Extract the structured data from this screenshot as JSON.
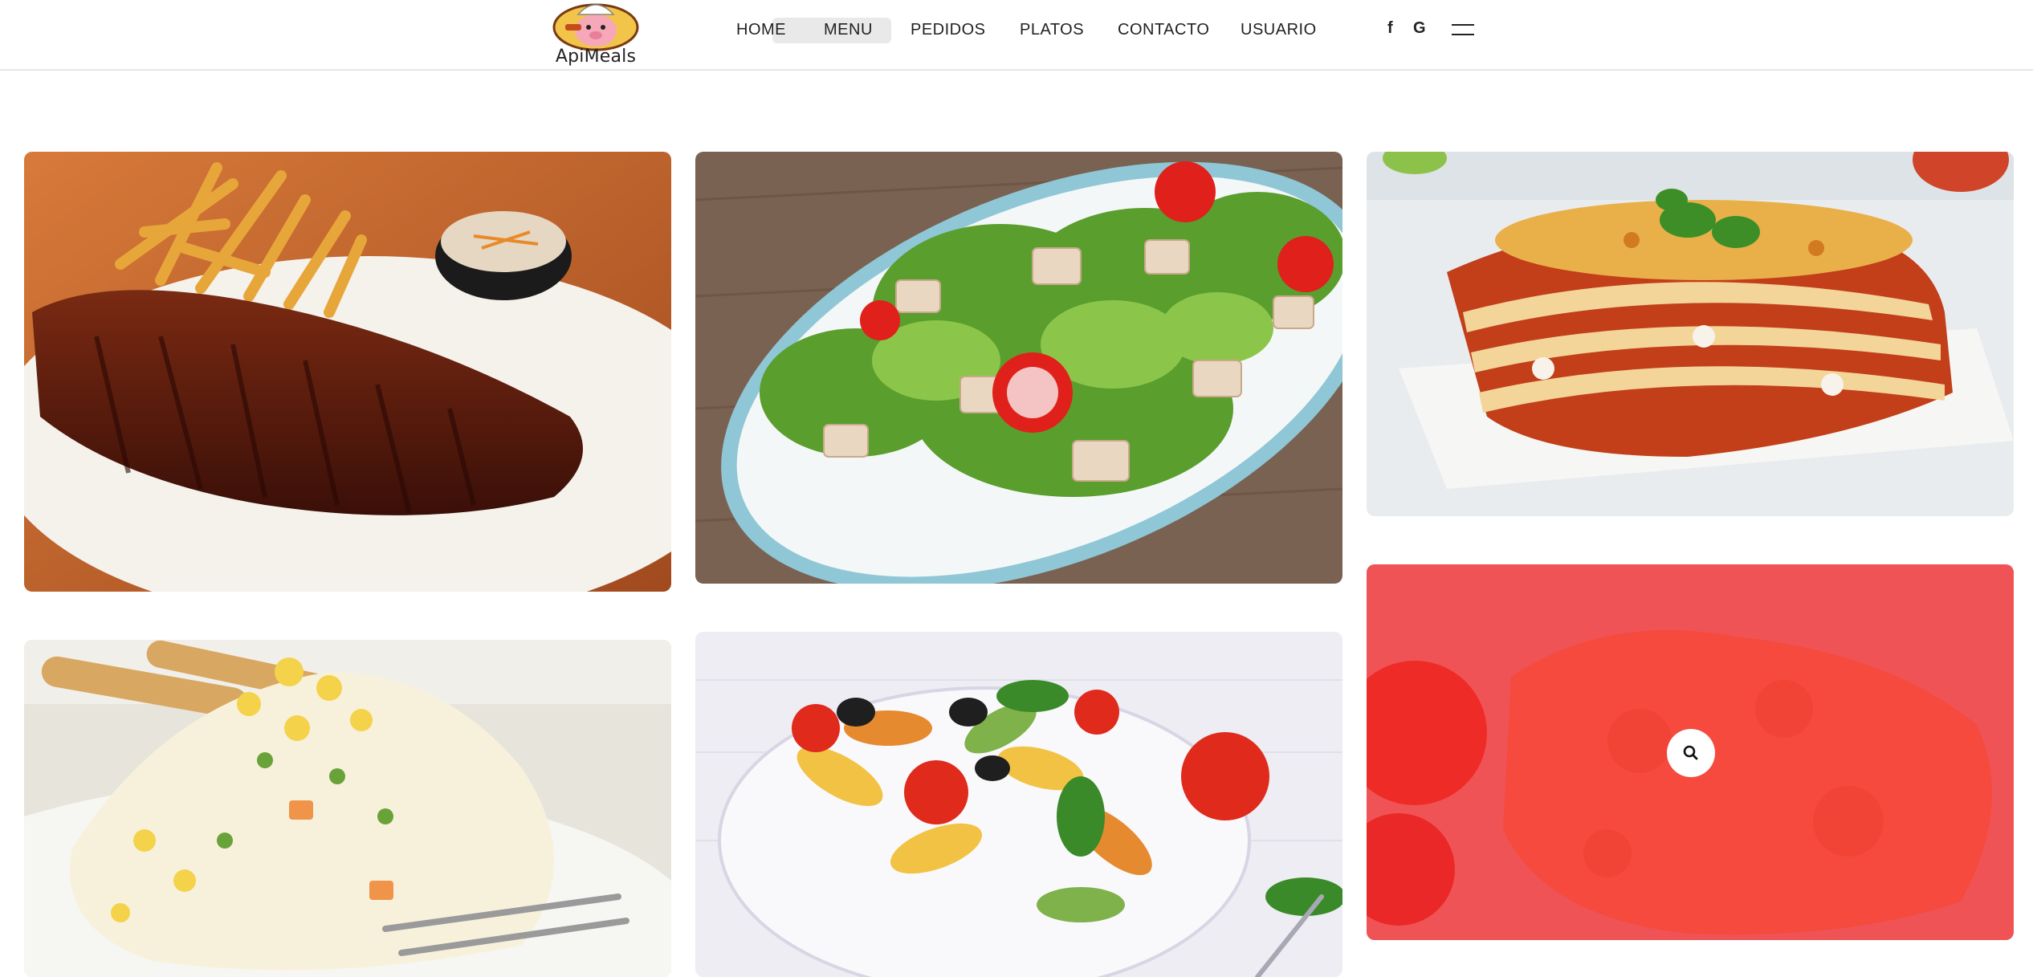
{
  "brand": {
    "name": "ApiMeals"
  },
  "nav": {
    "items": [
      "HOME",
      "MENU",
      "PEDIDOS",
      "PLATOS",
      "CONTACTO",
      "USUARIO"
    ],
    "social": [
      "f",
      "G"
    ]
  },
  "gallery": {
    "items": [
      {
        "name": "ribs-image",
        "icon": "ribs-photo"
      },
      {
        "name": "salad-image",
        "icon": "salad-photo"
      },
      {
        "name": "lasagna-image",
        "icon": "lasagna-photo"
      },
      {
        "name": "russian-salad-image",
        "icon": "potato-salad-photo"
      },
      {
        "name": "pasta-salad-image",
        "icon": "pasta-salad-photo"
      },
      {
        "name": "hovered-dish-image",
        "icon": "zoom-icon"
      }
    ],
    "hover_overlay_color": "#ff2a2e"
  },
  "colors": {
    "accent": "#ff2a2e",
    "text": "#222222"
  }
}
